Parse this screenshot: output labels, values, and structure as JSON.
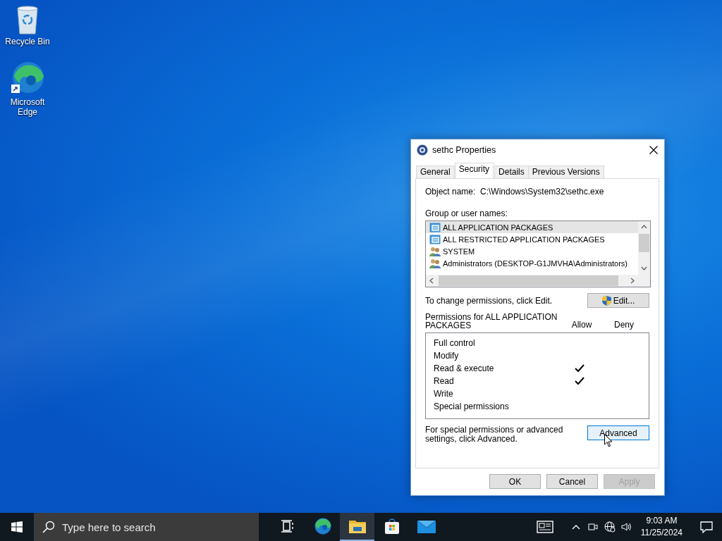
{
  "desktop_icons": [
    {
      "kind": "recycle",
      "label": "Recycle Bin"
    },
    {
      "kind": "edge",
      "label": "Microsoft Edge"
    }
  ],
  "dialog": {
    "title": "sethc Properties",
    "tabs": [
      {
        "label": "General",
        "selected": false
      },
      {
        "label": "Security",
        "selected": true
      },
      {
        "label": "Details",
        "selected": false
      },
      {
        "label": "Previous Versions",
        "selected": false
      }
    ],
    "object_name_label": "Object name:",
    "object_name": "C:\\Windows\\System32\\sethc.exe",
    "group_label": "Group or user names:",
    "groups": [
      {
        "kind": "package",
        "name": "ALL APPLICATION PACKAGES",
        "selected": true
      },
      {
        "kind": "package",
        "name": "ALL RESTRICTED APPLICATION PACKAGES",
        "selected": false
      },
      {
        "kind": "users",
        "name": "SYSTEM",
        "selected": false
      },
      {
        "kind": "users",
        "name": "Administrators (DESKTOP-G1JMVHA\\Administrators)",
        "selected": false
      }
    ],
    "change_hint": "To change permissions, click Edit.",
    "edit_button": "Edit...",
    "permissions_label": "Permissions for ALL APPLICATION PACKAGES",
    "allow_header": "Allow",
    "deny_header": "Deny",
    "permissions": [
      {
        "name": "Full control",
        "allow": false,
        "deny": false
      },
      {
        "name": "Modify",
        "allow": false,
        "deny": false
      },
      {
        "name": "Read & execute",
        "allow": true,
        "deny": false
      },
      {
        "name": "Read",
        "allow": true,
        "deny": false
      },
      {
        "name": "Write",
        "allow": false,
        "deny": false
      },
      {
        "name": "Special permissions",
        "allow": false,
        "deny": false
      }
    ],
    "advanced_hint": "For special permissions or advanced settings, click Advanced.",
    "advanced_button": "Advanced",
    "buttons": [
      {
        "label": "OK",
        "disabled": false
      },
      {
        "label": "Cancel",
        "disabled": false
      },
      {
        "label": "Apply",
        "disabled": true
      }
    ]
  },
  "taskbar": {
    "search_placeholder": "Type here to search",
    "apps": [
      {
        "kind": "taskview",
        "active": false
      },
      {
        "kind": "edge",
        "active": false
      },
      {
        "kind": "folder",
        "active": true
      },
      {
        "kind": "store",
        "active": false
      },
      {
        "kind": "mail",
        "active": false
      }
    ],
    "time": "9:03 AM",
    "date": "11/25/2024"
  }
}
